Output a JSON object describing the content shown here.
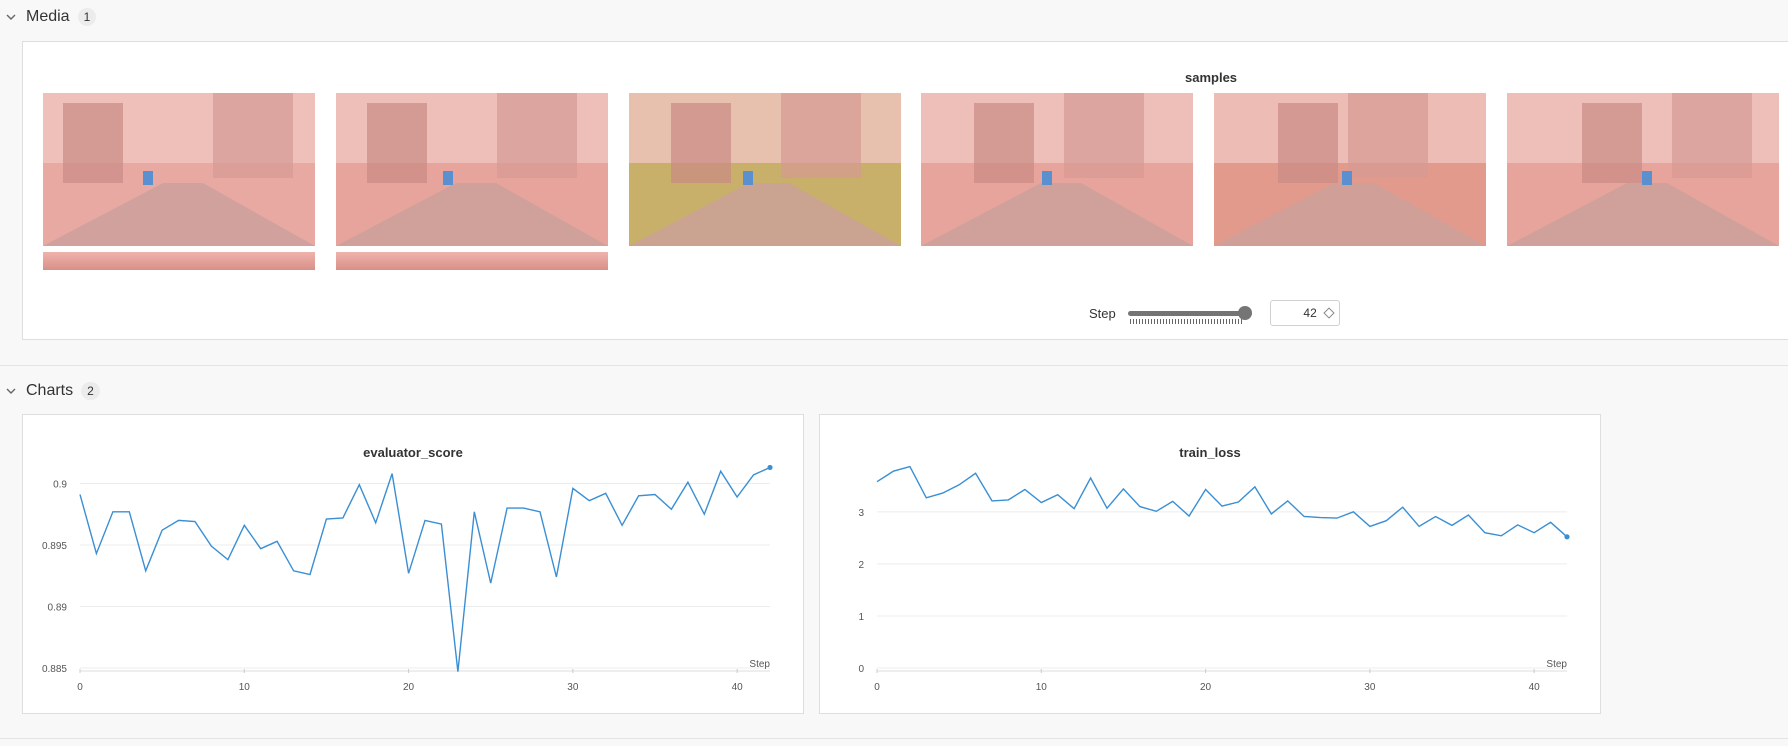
{
  "sections": {
    "media": {
      "label": "Media",
      "count": "1"
    },
    "charts": {
      "label": "Charts",
      "count": "2"
    }
  },
  "media_panel": {
    "title": "samples",
    "step_label": "Step",
    "step_value": "42",
    "slider_fraction": 1.0,
    "thumbnails": [
      {
        "name": "sample-1",
        "tint": "#e9a9a3"
      },
      {
        "name": "sample-2",
        "tint": "#e6a49c"
      },
      {
        "name": "sample-3",
        "tint": "#c8b06a"
      },
      {
        "name": "sample-4",
        "tint": "#e6a49c"
      },
      {
        "name": "sample-5",
        "tint": "#e29a8d"
      },
      {
        "name": "sample-6",
        "tint": "#e6a49c"
      }
    ]
  },
  "colors": {
    "line": "#3a8fd4",
    "grid": "#ececec",
    "axis_text": "#555555"
  },
  "charts": [
    {
      "title": "evaluator_score",
      "xlabel": "Step",
      "type": "line",
      "xlim": [
        0,
        42
      ],
      "ylim": [
        0.885,
        0.9015
      ],
      "yticks": [
        "0.885",
        "0.89",
        "0.895",
        "0.9"
      ],
      "xticks": [
        "0",
        "10",
        "20",
        "30",
        "40"
      ]
    },
    {
      "title": "train_loss",
      "xlabel": "Step",
      "type": "line",
      "xlim": [
        0,
        42
      ],
      "ylim": [
        0,
        3.9
      ],
      "yticks": [
        "0",
        "1",
        "2",
        "3"
      ],
      "xticks": [
        "0",
        "10",
        "20",
        "30",
        "40"
      ]
    }
  ],
  "chart_data": [
    {
      "type": "line",
      "title": "evaluator_score",
      "xlabel": "Step",
      "ylabel": "",
      "xlim": [
        0,
        42
      ],
      "ylim": [
        0.885,
        0.9015
      ],
      "x": [
        0,
        1,
        2,
        3,
        4,
        5,
        6,
        7,
        8,
        9,
        10,
        11,
        12,
        13,
        14,
        15,
        16,
        17,
        18,
        19,
        20,
        21,
        22,
        23,
        24,
        25,
        26,
        27,
        28,
        29,
        30,
        31,
        32,
        33,
        34,
        35,
        36,
        37,
        38,
        39,
        40,
        41,
        42
      ],
      "series": [
        {
          "values": [
            0.8991,
            0.8943,
            0.8977,
            0.8977,
            0.8929,
            0.8962,
            0.897,
            0.8969,
            0.8949,
            0.8938,
            0.8966,
            0.8947,
            0.8953,
            0.8929,
            0.8926,
            0.8971,
            0.8972,
            0.8999,
            0.8968,
            0.9008,
            0.8927,
            0.897,
            0.8967,
            0.8847,
            0.8977,
            0.8919,
            0.898,
            0.898,
            0.8977,
            0.8924,
            0.8996,
            0.8986,
            0.8992,
            0.8966,
            0.899,
            0.8991,
            0.8979,
            0.9001,
            0.8975,
            0.901,
            0.8989,
            0.9007,
            0.9013
          ]
        }
      ]
    },
    {
      "type": "line",
      "title": "train_loss",
      "xlabel": "Step",
      "ylabel": "",
      "xlim": [
        0,
        42
      ],
      "ylim": [
        0,
        3.9
      ],
      "x": [
        0,
        1,
        2,
        3,
        4,
        5,
        6,
        7,
        8,
        9,
        10,
        11,
        12,
        13,
        14,
        15,
        16,
        17,
        18,
        19,
        20,
        21,
        22,
        23,
        24,
        25,
        26,
        27,
        28,
        29,
        30,
        31,
        32,
        33,
        34,
        35,
        36,
        37,
        38,
        39,
        40,
        41,
        42
      ],
      "series": [
        {
          "values": [
            3.58,
            3.78,
            3.87,
            3.27,
            3.36,
            3.52,
            3.74,
            3.21,
            3.23,
            3.43,
            3.18,
            3.33,
            3.06,
            3.65,
            3.07,
            3.44,
            3.1,
            3.01,
            3.2,
            2.92,
            3.43,
            3.11,
            3.19,
            3.48,
            2.96,
            3.21,
            2.91,
            2.89,
            2.88,
            3.0,
            2.72,
            2.83,
            3.09,
            2.72,
            2.91,
            2.74,
            2.94,
            2.6,
            2.54,
            2.75,
            2.6,
            2.8,
            2.52
          ]
        }
      ]
    }
  ]
}
